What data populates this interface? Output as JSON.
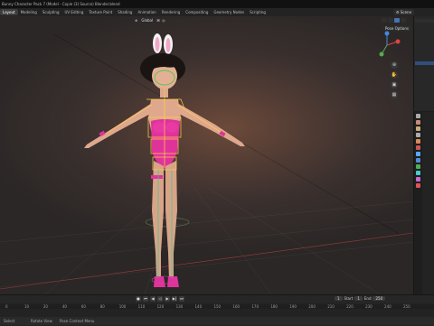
{
  "window": {
    "title": "Bunny Character Pack 7 (Model - Copie (3) Source) Blender.blend"
  },
  "workspace_tabs": [
    "Layout",
    "Modeling",
    "Sculpting",
    "UV Editing",
    "Texture Paint",
    "Shading",
    "Animation",
    "Rendering",
    "Compositing",
    "Geometry Nodes",
    "Scripting"
  ],
  "active_tab": "Layout",
  "scene": {
    "label": "Scene"
  },
  "viewport": {
    "mode": "Global",
    "pose_options": "Pose Options"
  },
  "timeline": {
    "current_frame": "1",
    "start_label": "Start",
    "start": "1",
    "end_label": "End",
    "end": "250",
    "ruler": [
      "0",
      "10",
      "20",
      "40",
      "60",
      "80",
      "100",
      "110",
      "120",
      "130",
      "140",
      "150",
      "160",
      "170",
      "180",
      "190",
      "200",
      "210",
      "220",
      "230",
      "240",
      "250"
    ]
  },
  "status": {
    "left": "Select",
    "middle": "Rotate View",
    "right": "Pose Context Menu"
  },
  "colors": {
    "accent": "#4772b3",
    "outfit": "#e0339a",
    "bone_select": "#ffd04a"
  }
}
